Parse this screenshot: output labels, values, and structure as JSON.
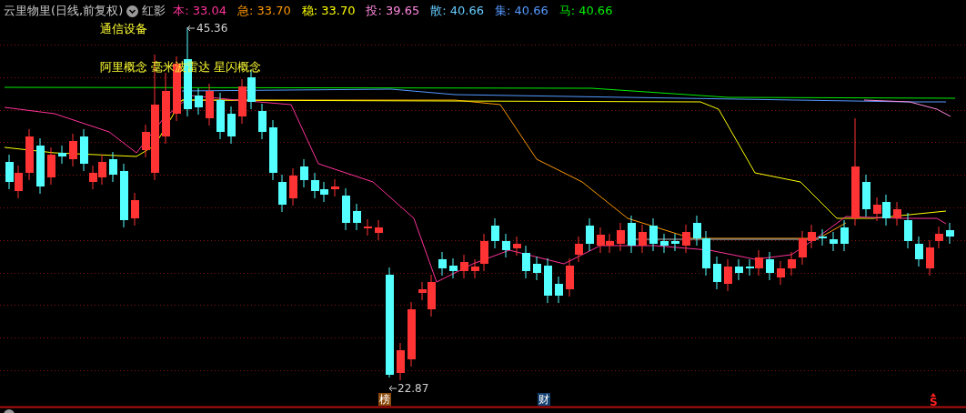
{
  "header": {
    "title": "云里物里(日线,前复权)",
    "indicator": "红影",
    "values": [
      {
        "text": "本: 33.04",
        "color": "#ff3399"
      },
      {
        "text": "急: 33.70",
        "color": "#ff9900"
      },
      {
        "text": "稳: 33.70",
        "color": "#ffff00"
      },
      {
        "text": "投: 39.65",
        "color": "#ff88dd"
      },
      {
        "text": "散: 40.66",
        "color": "#66ccff"
      },
      {
        "text": "集: 40.66",
        "color": "#5599ff"
      },
      {
        "text": "马: 40.66",
        "color": "#00ee00"
      }
    ]
  },
  "tags": {
    "industry": "通信设备",
    "concepts": "阿里概念 毫米波雷达 星闪概念"
  },
  "high_label": "45.36",
  "low_label": "22.87",
  "markers": [
    {
      "kind": "badge",
      "text": "榜",
      "color": "#8b4a0c"
    },
    {
      "kind": "badge",
      "text": "财",
      "color": "#123f6e"
    },
    {
      "kind": "signal",
      "text": "S",
      "color": "#ff2020"
    }
  ]
}
